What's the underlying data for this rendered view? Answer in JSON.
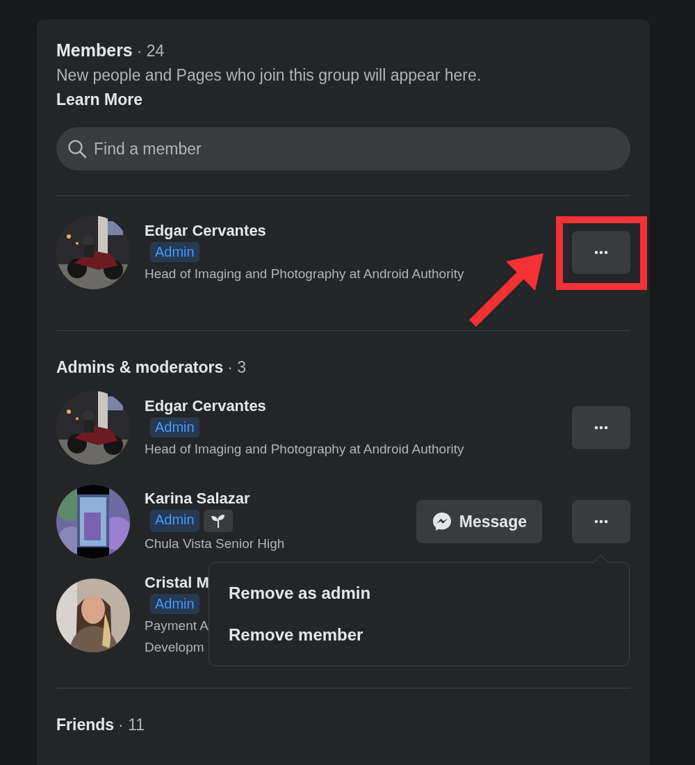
{
  "header": {
    "title": "Members",
    "count": "· 24",
    "description": "New people and Pages who join this group will appear here.",
    "link": "Learn More"
  },
  "search": {
    "placeholder": "Find a member"
  },
  "sections": [
    {
      "members": [
        {
          "name": "Edgar Cervantes",
          "badge": "Admin",
          "new_member": false,
          "description": [
            "Head of Imaging and Photography at Android Authority"
          ],
          "avatar": {
            "kind": "picture"
          },
          "more_button": true
        }
      ]
    },
    {
      "title": "Admins & moderators",
      "count": "· 3",
      "members": [
        {
          "name": "Edgar Cervantes",
          "badge": "Admin",
          "new_member": false,
          "description": [
            "Head of Imaging and Photography at Android Authority"
          ],
          "avatar": {
            "kind": "picture"
          },
          "more_button": true
        },
        {
          "name": "Karina Salazar",
          "badge": "Admin",
          "new_member": true,
          "description": [
            "Chula Vista Senior High"
          ],
          "avatar": {
            "kind": "picture"
          },
          "message_button": "Message",
          "more_button": true,
          "menu": [
            "Remove as admin",
            "Remove member"
          ]
        },
        {
          "name": "Cristal M",
          "badge": "Admin",
          "new_member": false,
          "description": [
            "Payment A",
            "Developm"
          ],
          "avatar": {
            "kind": "picture"
          },
          "more_button": false
        }
      ]
    },
    {
      "title": "Friends",
      "count": "· 11"
    }
  ]
}
